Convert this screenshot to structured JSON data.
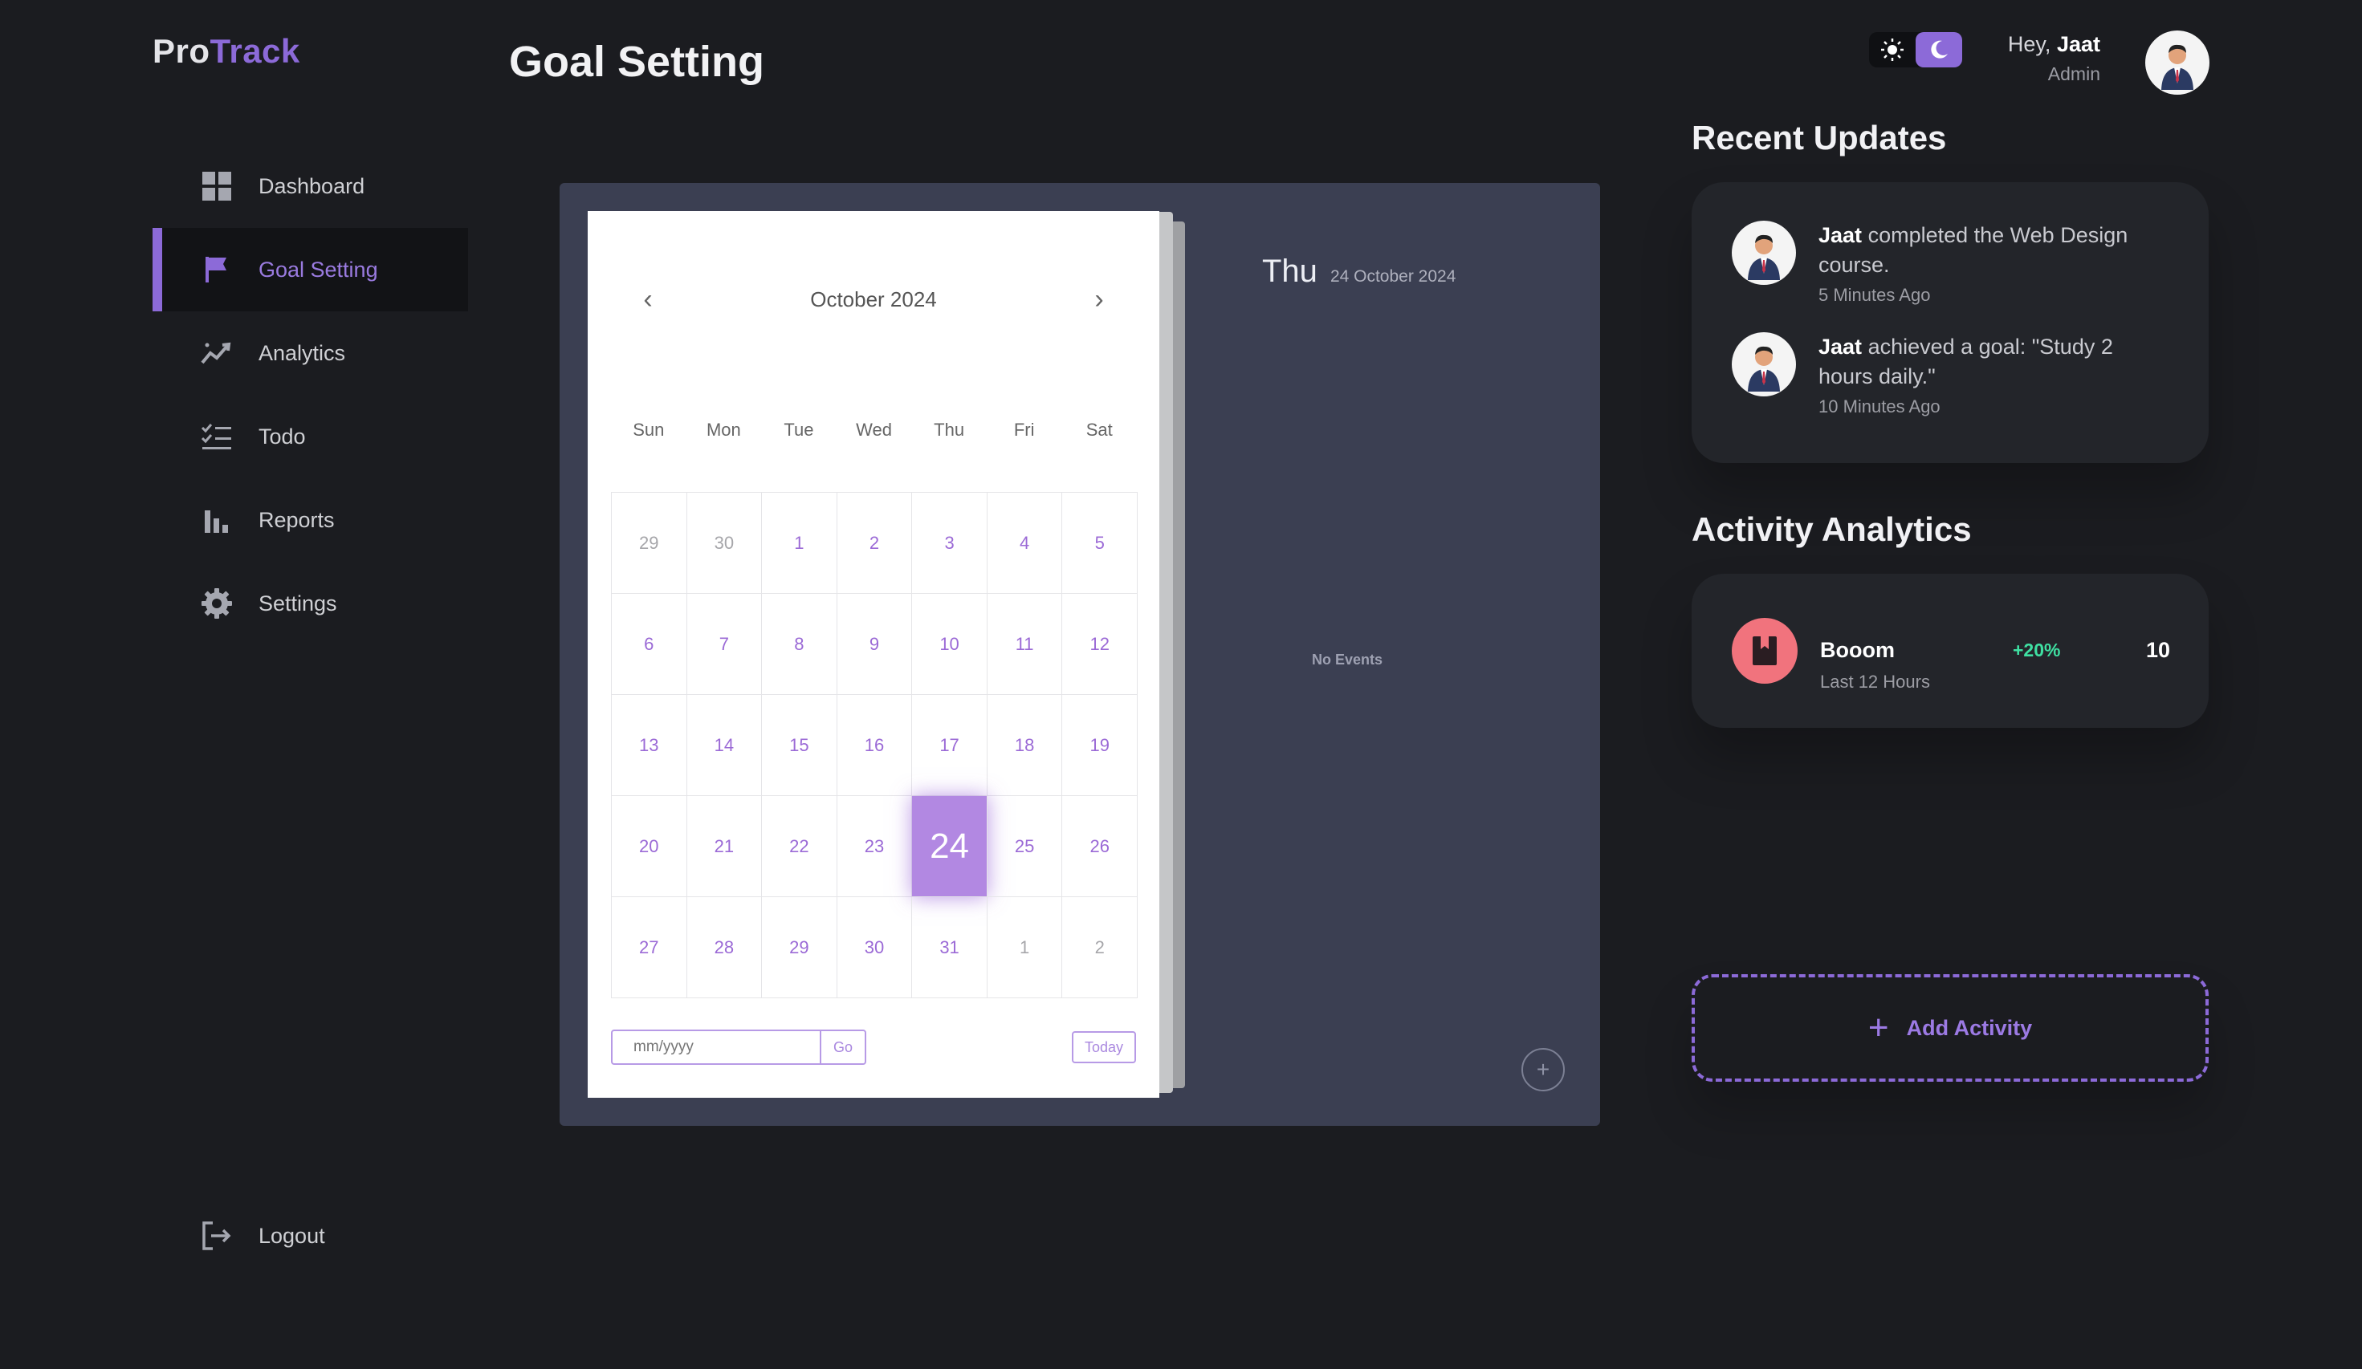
{
  "brand": {
    "part1": "Pro",
    "part2": "Track"
  },
  "page_title": "Goal Setting",
  "sidebar": {
    "items": [
      {
        "label": "Dashboard",
        "icon": "dashboard-grid-icon"
      },
      {
        "label": "Goal Setting",
        "icon": "flag-icon",
        "active": true
      },
      {
        "label": "Analytics",
        "icon": "trend-line-icon"
      },
      {
        "label": "Todo",
        "icon": "checklist-icon"
      },
      {
        "label": "Reports",
        "icon": "bar-chart-icon"
      },
      {
        "label": "Settings",
        "icon": "gear-icon"
      }
    ],
    "logout_label": "Logout"
  },
  "header": {
    "greeting": "Hey,",
    "user_name": "Jaat",
    "role": "Admin",
    "theme_toggle": {
      "light_icon": "sun-icon",
      "dark_icon": "moon-icon",
      "active": "dark"
    }
  },
  "calendar": {
    "month_label": "October 2024",
    "weekdays": [
      "Sun",
      "Mon",
      "Tue",
      "Wed",
      "Thu",
      "Fri",
      "Sat"
    ],
    "days": [
      {
        "d": "29",
        "m": true
      },
      {
        "d": "30",
        "m": true
      },
      {
        "d": "1"
      },
      {
        "d": "2"
      },
      {
        "d": "3"
      },
      {
        "d": "4"
      },
      {
        "d": "5"
      },
      {
        "d": "6"
      },
      {
        "d": "7"
      },
      {
        "d": "8"
      },
      {
        "d": "9"
      },
      {
        "d": "10"
      },
      {
        "d": "11"
      },
      {
        "d": "12"
      },
      {
        "d": "13"
      },
      {
        "d": "14"
      },
      {
        "d": "15"
      },
      {
        "d": "16"
      },
      {
        "d": "17"
      },
      {
        "d": "18"
      },
      {
        "d": "19"
      },
      {
        "d": "20"
      },
      {
        "d": "21"
      },
      {
        "d": "22"
      },
      {
        "d": "23"
      },
      {
        "d": "24",
        "today": true
      },
      {
        "d": "25"
      },
      {
        "d": "26"
      },
      {
        "d": "27"
      },
      {
        "d": "28"
      },
      {
        "d": "29"
      },
      {
        "d": "30"
      },
      {
        "d": "31"
      },
      {
        "d": "1",
        "m": true
      },
      {
        "d": "2",
        "m": true
      }
    ],
    "date_input_placeholder": "mm/yyyy",
    "go_label": "Go",
    "today_label": "Today"
  },
  "events": {
    "day_name": "Thu",
    "date_text": "24 October 2024",
    "empty_text": "No Events",
    "add_symbol": "+"
  },
  "recent_updates": {
    "title": "Recent Updates",
    "items": [
      {
        "name": "Jaat",
        "text": "completed the Web Design course.",
        "time": "5 Minutes Ago"
      },
      {
        "name": "Jaat",
        "text": "achieved a goal: \"Study 2 hours daily.\"",
        "time": "10 Minutes Ago"
      }
    ]
  },
  "activity_analytics": {
    "title": "Activity Analytics",
    "item": {
      "name": "Booom",
      "subtitle": "Last 12 Hours",
      "change": "+20%",
      "value": "10",
      "icon": "book-icon"
    }
  },
  "add_activity": {
    "symbol": "+",
    "label": "Add Activity"
  },
  "colors": {
    "accent": "#8c6ad8",
    "background": "#1b1c20",
    "panel": "#3b3f52",
    "positive": "#3fe0a2",
    "activity_icon_bg": "#f1737d"
  }
}
